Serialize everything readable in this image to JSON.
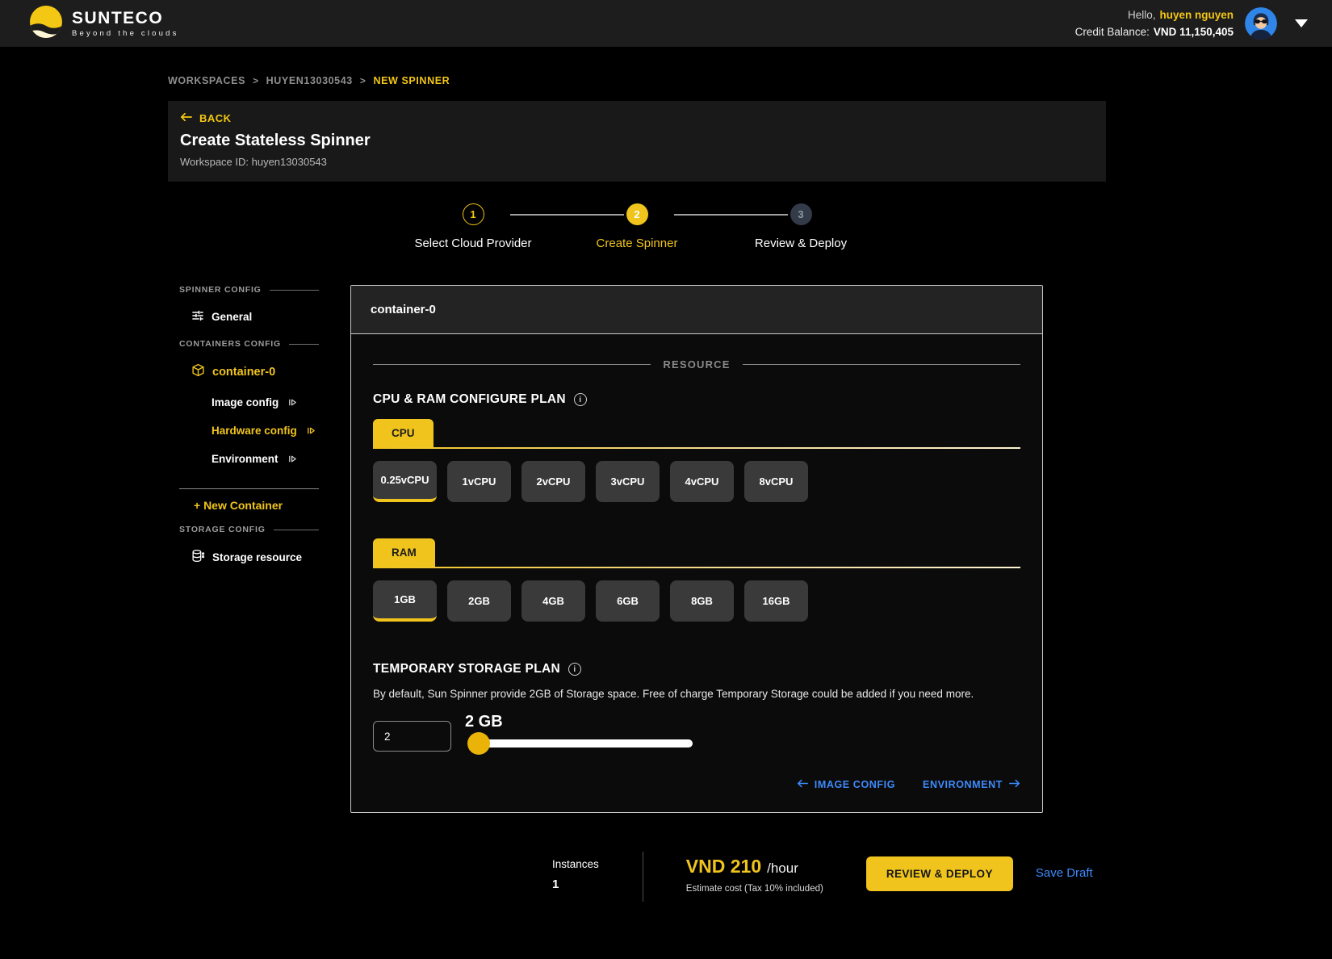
{
  "topbar": {
    "brand": "SUNTECO",
    "tagline": "Beyond the clouds",
    "greeting": "Hello,",
    "username": "huyen nguyen",
    "credit_label": "Credit Balance:",
    "credit_value": "VND 11,150,405"
  },
  "breadcrumb": {
    "items": [
      "WORKSPACES",
      "HUYEN13030543",
      "NEW SPINNER"
    ]
  },
  "header": {
    "back": "BACK",
    "title": "Create Stateless Spinner",
    "workspace": "Workspace ID: huyen13030543"
  },
  "stepper": {
    "steps": [
      {
        "num": "1",
        "label": "Select Cloud Provider",
        "state": "done"
      },
      {
        "num": "2",
        "label": "Create Spinner",
        "state": "active"
      },
      {
        "num": "3",
        "label": "Review & Deploy",
        "state": "pending"
      }
    ]
  },
  "sidebar": {
    "spinner_config": "SPINNER CONFIG",
    "general": "General",
    "containers_config": "CONTAINERS CONFIG",
    "container": "container-0",
    "image_config": "Image config",
    "hardware_config": "Hardware config",
    "environment": "Environment",
    "new_container": "+ New Container",
    "storage_config": "STORAGE CONFIG",
    "storage_resource": "Storage resource"
  },
  "panel": {
    "container_title": "container-0",
    "divider": "RESOURCE",
    "cpu_ram_heading": "CPU & RAM CONFIGURE PLAN",
    "cpu_tab": "CPU",
    "cpu_options": [
      "0.25vCPU",
      "1vCPU",
      "2vCPU",
      "3vCPU",
      "4vCPU",
      "8vCPU"
    ],
    "cpu_selected": "0.25vCPU",
    "ram_tab": "RAM",
    "ram_options": [
      "1GB",
      "2GB",
      "4GB",
      "6GB",
      "8GB",
      "16GB"
    ],
    "ram_selected": "1GB",
    "storage_heading": "TEMPORARY STORAGE PLAN",
    "storage_description": "By default, Sun Spinner provide 2GB of Storage space. Free of charge Temporary Storage could be added if you need more.",
    "storage_input_value": "2",
    "storage_value_label": "2 GB",
    "prev_link": "IMAGE CONFIG",
    "next_link": "ENVIRONMENT"
  },
  "bottombar": {
    "instances_label": "Instances",
    "instances_value": "1",
    "price": "VND 210",
    "price_unit": "/hour",
    "estimate_note": "Estimate cost (Tax 10% included)",
    "review_deploy": "REVIEW & DEPLOY",
    "save_draft": "Save Draft"
  },
  "colors": {
    "accent_yellow": "#f0c41d",
    "link_blue": "#3d8bfd",
    "avatar_blue": "#2f86e8",
    "chip_bg": "#3a3a3a",
    "slider_thumb": "#eab308",
    "topbar_bg": "#1d1d1d",
    "page_bg": "#000000"
  },
  "icons": {
    "logo": "sun-over-clouds",
    "general": "tune-lines",
    "container": "cube",
    "storage": "database-cylinder",
    "subnav": "skip-forward",
    "info": "circled-i",
    "back": "arrow-left",
    "caret": "triangle-down"
  }
}
